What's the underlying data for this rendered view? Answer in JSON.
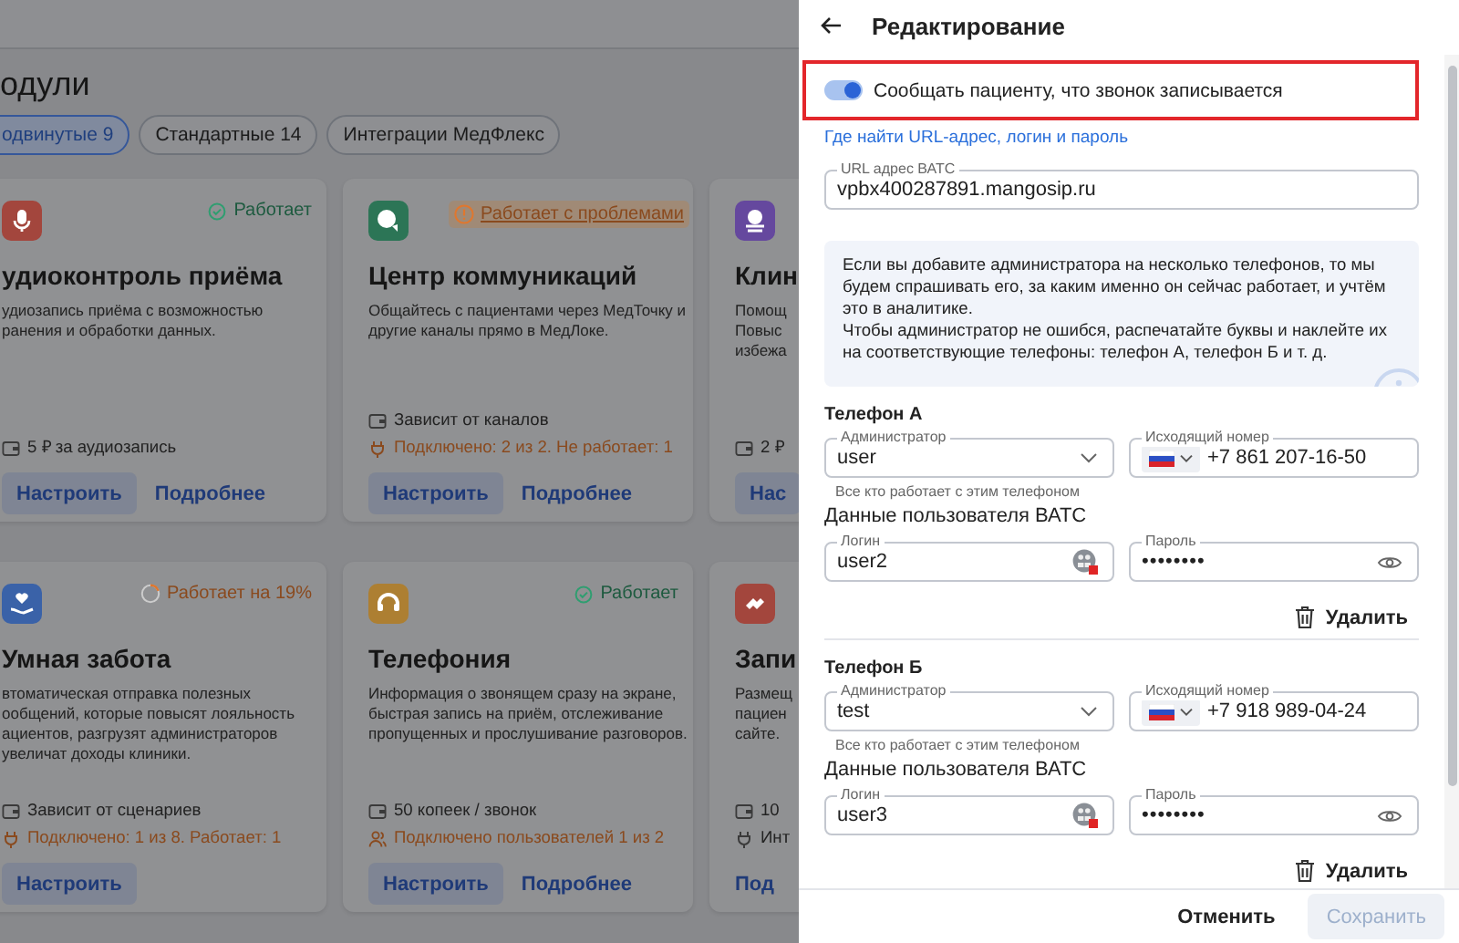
{
  "page": {
    "title": "одули",
    "filters": [
      {
        "label": "одвинутые 9",
        "selected": true
      },
      {
        "label": "Стандартные 14",
        "selected": false
      },
      {
        "label": "Интеграции МедФлекс",
        "selected": false
      }
    ],
    "cards": [
      {
        "title": "удиоконтроль приёма",
        "color": "#a3463d",
        "status": {
          "kind": "ok",
          "text": "Работает"
        },
        "description": [
          "удиозапись приёма с возможностью",
          "ранения и обработки данных."
        ],
        "meta": [
          {
            "kind": "price",
            "warning": false,
            "text": "5 ₽ за аудиозапись"
          }
        ],
        "buttons": [
          {
            "kind": "primary",
            "label": "Настроить"
          },
          {
            "kind": "link",
            "label": "Подробнее"
          }
        ]
      },
      {
        "title": "Центр коммуникаций",
        "color": "#2c7556",
        "status": {
          "kind": "problem",
          "text": "Работает с проблемами"
        },
        "description": [
          "Общайтесь с пациентами через МедТочку и",
          "другие каналы прямо в МедЛоке."
        ],
        "meta": [
          {
            "kind": "price",
            "warning": false,
            "text": "Зависит от каналов"
          },
          {
            "kind": "plug",
            "warning": true,
            "text": "Подключено: 2 из 2. Не работает: 1"
          }
        ],
        "buttons": [
          {
            "kind": "primary",
            "label": "Настроить"
          },
          {
            "kind": "link",
            "label": "Подробнее"
          }
        ]
      },
      {
        "title": "Клин",
        "color": "#65489e",
        "description": [
          "Помощ",
          "Повыс",
          "избежа"
        ],
        "meta": [
          {
            "kind": "price",
            "warning": false,
            "text": "2 ₽"
          }
        ],
        "buttons": [
          {
            "kind": "primary",
            "label": "Нас"
          }
        ]
      },
      {
        "title": "Умная забота",
        "color": "#3a62a8",
        "status": {
          "kind": "progress",
          "text": "Работает на 19%"
        },
        "description": [
          "втоматическая отправка полезных",
          "ообщений, которые повысят лояльность",
          "ациентов, разгрузят администраторов",
          "увеличат доходы клиники."
        ],
        "meta": [
          {
            "kind": "price",
            "warning": false,
            "text": "Зависит от сценариев"
          },
          {
            "kind": "plug",
            "warning": true,
            "text": "Подключено: 1 из 8. Работает: 1"
          }
        ],
        "buttons": [
          {
            "kind": "primary",
            "label": "Настроить"
          }
        ]
      },
      {
        "title": "Телефония",
        "color": "#ad7f32",
        "status": {
          "kind": "ok",
          "text": "Работает"
        },
        "description": [
          "Информация о звонящем сразу на экране,",
          "быстрая запись на приём, отслеживание",
          "пропущенных и прослушивание разговоров."
        ],
        "meta": [
          {
            "kind": "price",
            "warning": false,
            "text": "50 копеек / звонок"
          },
          {
            "kind": "users",
            "warning": true,
            "text": "Подключено пользователей 1 из 2"
          }
        ],
        "buttons": [
          {
            "kind": "primary",
            "label": "Настроить"
          },
          {
            "kind": "link",
            "label": "Подробнее"
          }
        ]
      },
      {
        "title": "Запи",
        "color": "#a3463d",
        "description": [
          "Размещ",
          "пациен",
          "сайте."
        ],
        "meta": [
          {
            "kind": "price",
            "warning": false,
            "text": "10"
          },
          {
            "kind": "plug",
            "warning": false,
            "text": "Инт"
          }
        ],
        "buttons": [
          {
            "kind": "link",
            "label": "Под"
          }
        ]
      }
    ]
  },
  "drawer": {
    "title": "Редактирование",
    "record_notice": {
      "label": "Сообщать пациенту, что звонок записывается",
      "on": true,
      "highlighted": true
    },
    "help_link": "Где найти URL-адрес, логин и пароль",
    "url_field": {
      "label": "URL адрес ВАТС",
      "value": "vpbx400287891.mangosip.ru"
    },
    "info": [
      "Если вы добавите администратора на несколько телефонов, то мы будем спрашивать его, за каким именно он сейчас работает, и учтём это в аналитике.",
      "Чтобы администратор не ошибся, распечатайте буквы и наклейте их на соответствующие телефоны: телефон А, телефон Б и т. д."
    ],
    "phones": [
      {
        "title": "Телефон А",
        "admin": {
          "label": "Администратор",
          "value": "user",
          "hint": "Все кто работает с этим телефоном"
        },
        "number": {
          "label": "Исходящий номер",
          "value": "+7 861 207-16-50"
        },
        "credentials_title": "Данные пользователя ВАТС",
        "login": {
          "label": "Логин",
          "value": "user2"
        },
        "password": {
          "label": "Пароль",
          "value": "••••••••"
        },
        "delete": "Удалить"
      },
      {
        "title": "Телефон Б",
        "admin": {
          "label": "Администратор",
          "value": "test",
          "hint": "Все кто работает с этим телефоном"
        },
        "number": {
          "label": "Исходящий номер",
          "value": "+7 918 989-04-24"
        },
        "credentials_title": "Данные пользователя ВАТС",
        "login": {
          "label": "Логин",
          "value": "user3"
        },
        "password": {
          "label": "Пароль",
          "value": "••••••••"
        },
        "delete": "Удалить"
      }
    ],
    "footer": {
      "cancel": "Отменить",
      "save": "Сохранить",
      "save_disabled": true
    }
  }
}
